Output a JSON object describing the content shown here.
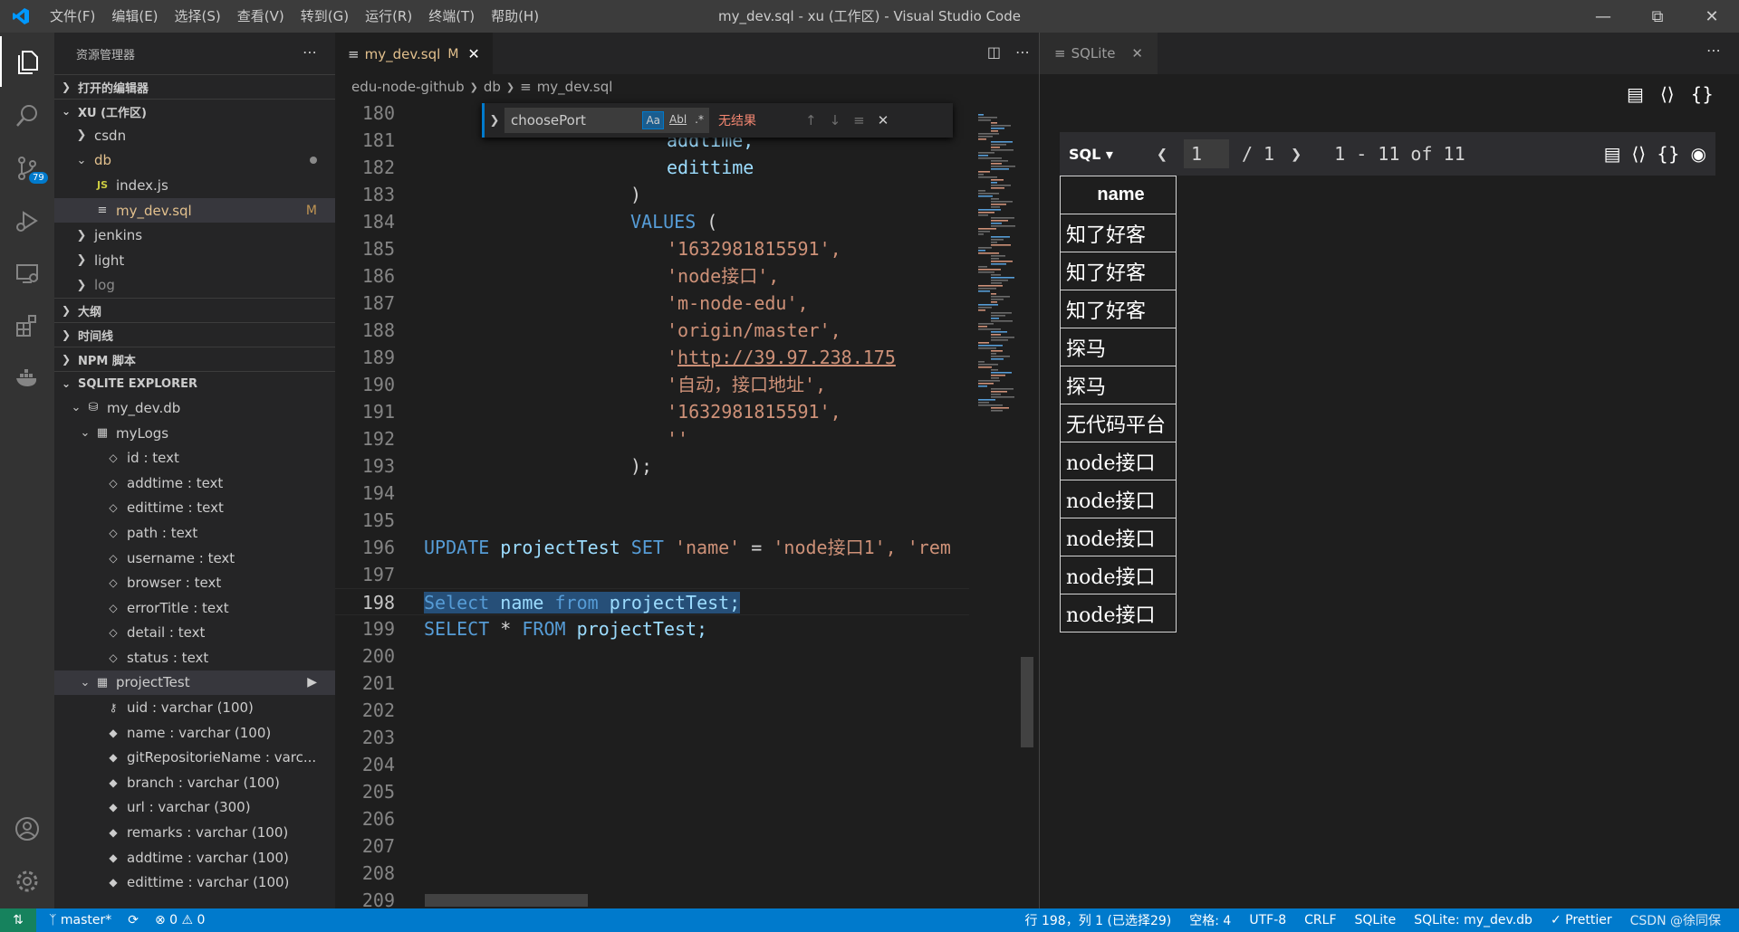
{
  "titlebar": {
    "menu": [
      "文件(F)",
      "编辑(E)",
      "选择(S)",
      "查看(V)",
      "转到(G)",
      "运行(R)",
      "终端(T)",
      "帮助(H)"
    ],
    "title": "my_dev.sql - xu (工作区) - Visual Studio Code"
  },
  "activity": {
    "badge": "79"
  },
  "sidebar": {
    "header": "资源管理器",
    "sections": {
      "open_editors": "打开的编辑器",
      "workspace": "XU (工作区)",
      "outline": "大纲",
      "timeline": "时间线",
      "npm": "NPM 脚本",
      "sqlite": "SQLITE EXPLORER"
    },
    "files": {
      "csdn": "csdn",
      "db": "db",
      "indexjs": "index.js",
      "mydev": "my_dev.sql",
      "mydev_mark": "M",
      "jenkins": "jenkins",
      "light": "light",
      "log": "log"
    },
    "sqlite": {
      "dbname": "my_dev.db",
      "table1": "myLogs",
      "cols1": [
        "id : text",
        "addtime : text",
        "edittime : text",
        "path : text",
        "username : text",
        "browser : text",
        "errorTitle : text",
        "detail : text",
        "status : text"
      ],
      "table2": "projectTest",
      "cols2": [
        "uid : varchar (100)",
        "name : varchar (100)",
        "gitRepositorieName : varc...",
        "branch : varchar (100)",
        "url : varchar (300)",
        "remarks : varchar (100)",
        "addtime : varchar (100)",
        "edittime : varchar (100)"
      ]
    }
  },
  "editor": {
    "tab_label": "my_dev.sql",
    "tab_mark": "M",
    "breadcrumb": [
      "edu-node-github",
      "db",
      "my_dev.sql"
    ],
    "find": {
      "query": "choosePort",
      "opt_case": "Aa",
      "opt_word": "Abl",
      "opt_regex": ".*",
      "result": "无结果"
    },
    "lines": [
      "180",
      "181",
      "182",
      "183",
      "184",
      "185",
      "186",
      "187",
      "188",
      "189",
      "190",
      "191",
      "192",
      "193",
      "194",
      "195",
      "196",
      "197",
      "198",
      "199",
      "200",
      "201",
      "202",
      "203",
      "204",
      "205",
      "206",
      "207",
      "208",
      "209"
    ],
    "code": {
      "l181": "addtime,",
      "l182": "edittime",
      "l183": ")",
      "l184_kw": "VALUES",
      "l184_rest": " (",
      "l185": "'1632981815591',",
      "l186": "'node接口',",
      "l187": "'m-node-edu',",
      "l188": "'origin/master',",
      "l189_q": "'",
      "l189_url": "http://39.97.238.175",
      "l190": "'自动，接口地址',",
      "l191": "'1632981815591',",
      "l192": "''",
      "l193": ");",
      "l196_kw1": "UPDATE",
      "l196_t": "projectTest",
      "l196_kw2": "SET",
      "l196_s1": "'name'",
      "l196_eq": "=",
      "l196_s2": "'node接口1',",
      "l196_s3": "'rem",
      "l198_kw1": "Select",
      "l198_c": "name",
      "l198_kw2": "from",
      "l198_t": "projectTest;",
      "l199_kw1": "SELECT",
      "l199_star": "*",
      "l199_kw2": "FROM",
      "l199_t": "projectTest;"
    }
  },
  "sqlite_panel": {
    "tab": "SQLite",
    "sql_label": "SQL ▾",
    "page": "1",
    "of_pages": "/ 1",
    "range": "1 - 11 of 11",
    "column": "name",
    "rows": [
      "知了好客",
      "知了好客",
      "知了好客",
      "探马",
      "探马",
      "无代码平台",
      "node接口",
      "node接口",
      "node接口",
      "node接口",
      "node接口"
    ]
  },
  "statusbar": {
    "branch": "master*",
    "problems": "0",
    "warnings": "0",
    "position": "行 198，列 1 (已选择29)",
    "spaces": "空格: 4",
    "encoding": "UTF-8",
    "eol": "CRLF",
    "lang": "SQLite",
    "sqlitedb": "SQLite: my_dev.db",
    "prettier": "Prettier",
    "watermark": "CSDN @徐同保"
  }
}
